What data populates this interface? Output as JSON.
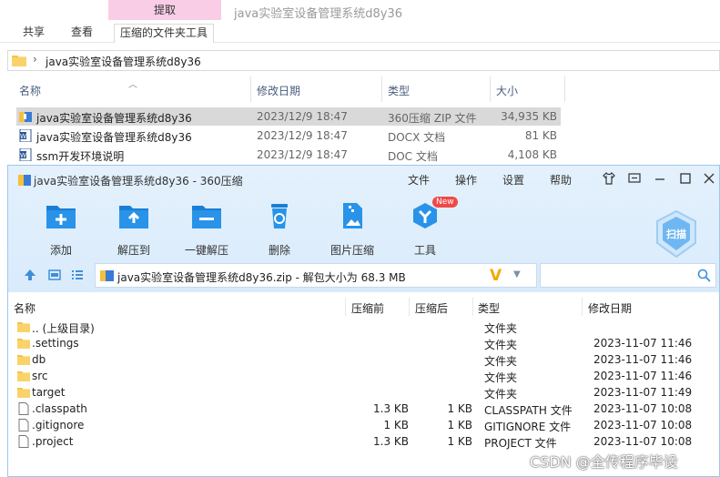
{
  "explorer": {
    "ribbon": {
      "context_tab": "提取",
      "window_title": "java实验室设备管理系统d8y36",
      "tabs": [
        "共享",
        "查看",
        "压缩的文件夹工具"
      ]
    },
    "address": {
      "separator": "›",
      "path": "java实验室设备管理系统d8y36"
    },
    "columns": [
      "名称",
      "修改日期",
      "类型",
      "大小"
    ],
    "files": [
      {
        "name": "java实验室设备管理系统d8y36",
        "date": "2023/12/9 18:47",
        "type": "360压缩 ZIP 文件",
        "size": "34,935 KB",
        "icon": "zip-icon",
        "selected": true
      },
      {
        "name": "java实验室设备管理系统d8y36",
        "date": "2023/12/9 18:47",
        "type": "DOCX 文档",
        "size": "81 KB",
        "icon": "word-doc-icon",
        "selected": false
      },
      {
        "name": "ssm开发环境说明",
        "date": "2023/12/9 18:47",
        "type": "DOC 文档",
        "size": "4,108 KB",
        "icon": "word-doc-icon",
        "selected": false
      }
    ]
  },
  "zip": {
    "title": "java实验室设备管理系统d8y36 - 360压缩",
    "menu": [
      "文件",
      "操作",
      "设置",
      "帮助"
    ],
    "tools": [
      {
        "label": "添加",
        "icon": "add-folder-icon"
      },
      {
        "label": "解压到",
        "icon": "extract-to-icon"
      },
      {
        "label": "一键解压",
        "icon": "one-click-extract-icon"
      },
      {
        "label": "删除",
        "icon": "recycle-bin-icon"
      },
      {
        "label": "图片压缩",
        "icon": "image-compress-icon"
      },
      {
        "label": "工具",
        "icon": "tools-icon"
      }
    ],
    "tools_badge": "New",
    "scan_label": "扫描",
    "path": "java实验室设备管理系统d8y36.zip - 解包大小为 68.3 MB",
    "search_placeholder": "",
    "columns": [
      "名称",
      "压缩前",
      "压缩后",
      "类型",
      "修改日期"
    ],
    "rows": [
      {
        "name": ".. (上级目录)",
        "before": "",
        "after": "",
        "type": "文件夹",
        "date": "",
        "kind": "folder"
      },
      {
        "name": ".settings",
        "before": "",
        "after": "",
        "type": "文件夹",
        "date": "2023-11-07 11:46",
        "kind": "folder"
      },
      {
        "name": "db",
        "before": "",
        "after": "",
        "type": "文件夹",
        "date": "2023-11-07 11:46",
        "kind": "folder"
      },
      {
        "name": "src",
        "before": "",
        "after": "",
        "type": "文件夹",
        "date": "2023-11-07 11:46",
        "kind": "folder"
      },
      {
        "name": "target",
        "before": "",
        "after": "",
        "type": "文件夹",
        "date": "2023-11-07 11:49",
        "kind": "folder"
      },
      {
        "name": ".classpath",
        "before": "1.3 KB",
        "after": "1 KB",
        "type": "CLASSPATH 文件",
        "date": "2023-11-07 10:08",
        "kind": "file"
      },
      {
        "name": ".gitignore",
        "before": "1 KB",
        "after": "1 KB",
        "type": "GITIGNORE 文件",
        "date": "2023-11-07 10:08",
        "kind": "file"
      },
      {
        "name": ".project",
        "before": "1.3 KB",
        "after": "1 KB",
        "type": "PROJECT 文件",
        "date": "2023-11-07 10:08",
        "kind": "file"
      }
    ]
  },
  "watermark": "CSDN @全传程序毕设",
  "colors": {
    "accent": "#1a7fd4",
    "zip_header": "#e4f1fd",
    "context_tab": "#f9cde6",
    "folder": "#f6c445"
  }
}
